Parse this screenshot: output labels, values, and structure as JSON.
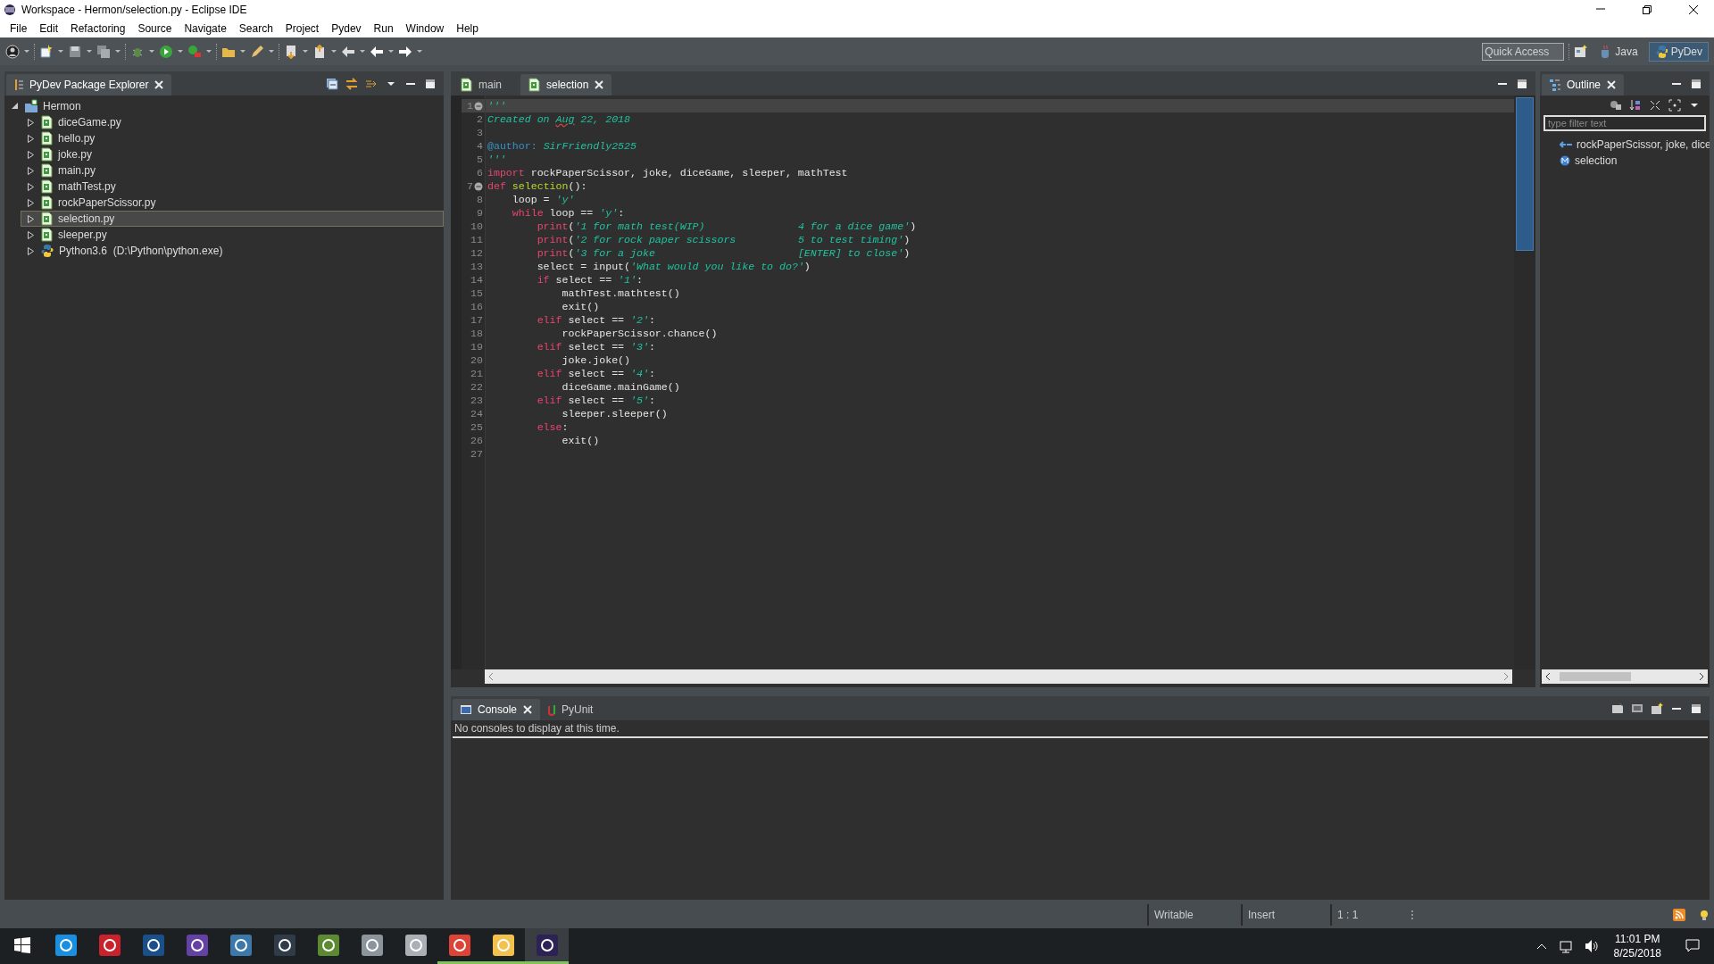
{
  "window": {
    "title": "Workspace - Hermon/selection.py - Eclipse IDE"
  },
  "menu": [
    "File",
    "Edit",
    "Refactoring",
    "Source",
    "Navigate",
    "Search",
    "Project",
    "Pydev",
    "Run",
    "Window",
    "Help"
  ],
  "toolbar": {
    "quick_access": {
      "placeholder": "Quick Access"
    },
    "perspectives": [
      {
        "label": "Java",
        "selected": false
      },
      {
        "label": "PyDev",
        "selected": true
      }
    ]
  },
  "explorer": {
    "title": "PyDev Package Explorer",
    "tree": [
      {
        "label": "Hermon",
        "kind": "project",
        "expanded": true,
        "selected": false,
        "children": [
          {
            "label": "diceGame.py",
            "kind": "file",
            "expanded": false,
            "selected": false
          },
          {
            "label": "hello.py",
            "kind": "file",
            "expanded": false,
            "selected": false
          },
          {
            "label": "joke.py",
            "kind": "file",
            "expanded": false,
            "selected": false
          },
          {
            "label": "main.py",
            "kind": "file",
            "expanded": false,
            "selected": false
          },
          {
            "label": "mathTest.py",
            "kind": "file",
            "expanded": false,
            "selected": false
          },
          {
            "label": "rockPaperScissor.py",
            "kind": "file",
            "expanded": false,
            "selected": false
          },
          {
            "label": "selection.py",
            "kind": "file",
            "expanded": false,
            "selected": true
          },
          {
            "label": "sleeper.py",
            "kind": "file",
            "expanded": false,
            "selected": false
          },
          {
            "label": "Python3.6  (D:\\Python\\python.exe)",
            "kind": "interpreter",
            "expanded": false,
            "selected": false
          }
        ]
      }
    ]
  },
  "editor": {
    "tabs": [
      {
        "label": "main",
        "selected": false
      },
      {
        "label": "selection",
        "selected": true
      }
    ],
    "lines": [
      {
        "number": "1",
        "fold": true,
        "current": true,
        "tokens": [
          {
            "kind": "string",
            "text": "'''"
          }
        ]
      },
      {
        "number": "2",
        "fold": false,
        "current": false,
        "tokens": [
          {
            "kind": "string",
            "text": "Created on "
          },
          {
            "kind": "string",
            "text": "Aug",
            "misspelled": true
          },
          {
            "kind": "string",
            "text": " 22, 2018"
          }
        ]
      },
      {
        "number": "3",
        "fold": false,
        "current": false
      },
      {
        "number": "4",
        "fold": false,
        "current": false,
        "tokens": [
          {
            "kind": "decorator",
            "text": "@author:"
          },
          {
            "kind": "string",
            "text": " SirFriendly2525"
          }
        ]
      },
      {
        "number": "5",
        "fold": false,
        "current": false,
        "tokens": [
          {
            "kind": "string",
            "text": "'''"
          }
        ]
      },
      {
        "number": "6",
        "fold": false,
        "current": false,
        "tokens": [
          {
            "kind": "keyword",
            "text": "import"
          },
          {
            "kind": "plain",
            "text": " rockPaperScissor, joke, diceGame, sleeper, mathTest"
          }
        ]
      },
      {
        "number": "7",
        "fold": true,
        "current": false,
        "tokens": [
          {
            "kind": "keyword",
            "text": "def "
          },
          {
            "kind": "function",
            "text": "selection"
          },
          {
            "kind": "plain",
            "text": "():"
          }
        ]
      },
      {
        "number": "8",
        "fold": false,
        "current": false,
        "tokens": [
          {
            "kind": "plain",
            "text": "    loop = "
          },
          {
            "kind": "string",
            "text": "'y'"
          }
        ]
      },
      {
        "number": "9",
        "fold": false,
        "current": false,
        "tokens": [
          {
            "kind": "keyword",
            "text": "    while"
          },
          {
            "kind": "plain",
            "text": " loop == "
          },
          {
            "kind": "string",
            "text": "'y'"
          },
          {
            "kind": "plain",
            "text": ":"
          }
        ]
      },
      {
        "number": "10",
        "fold": false,
        "current": false,
        "tokens": [
          {
            "kind": "keyword",
            "text": "        print"
          },
          {
            "kind": "plain",
            "text": "("
          },
          {
            "kind": "string",
            "text": "'1 for math test(WIP)               4 for a dice game'"
          },
          {
            "kind": "plain",
            "text": ")"
          }
        ]
      },
      {
        "number": "11",
        "fold": false,
        "current": false,
        "tokens": [
          {
            "kind": "keyword",
            "text": "        print"
          },
          {
            "kind": "plain",
            "text": "("
          },
          {
            "kind": "string",
            "text": "'2 for rock paper scissors          5 to test timing'"
          },
          {
            "kind": "plain",
            "text": ")"
          }
        ]
      },
      {
        "number": "12",
        "fold": false,
        "current": false,
        "tokens": [
          {
            "kind": "keyword",
            "text": "        print"
          },
          {
            "kind": "plain",
            "text": "("
          },
          {
            "kind": "string",
            "text": "'3 for a joke                       [ENTER] to close'"
          },
          {
            "kind": "plain",
            "text": ")"
          }
        ]
      },
      {
        "number": "13",
        "fold": false,
        "current": false,
        "tokens": [
          {
            "kind": "plain",
            "text": "        select = input("
          },
          {
            "kind": "string",
            "text": "'What would you like to do?'"
          },
          {
            "kind": "plain",
            "text": ")"
          }
        ]
      },
      {
        "number": "14",
        "fold": false,
        "current": false,
        "tokens": [
          {
            "kind": "keyword",
            "text": "        if"
          },
          {
            "kind": "plain",
            "text": " select == "
          },
          {
            "kind": "string",
            "text": "'1'"
          },
          {
            "kind": "plain",
            "text": ":"
          }
        ]
      },
      {
        "number": "15",
        "fold": false,
        "current": false,
        "tokens": [
          {
            "kind": "plain",
            "text": "            mathTest.mathtest()"
          }
        ]
      },
      {
        "number": "16",
        "fold": false,
        "current": false,
        "tokens": [
          {
            "kind": "plain",
            "text": "            exit()"
          }
        ]
      },
      {
        "number": "17",
        "fold": false,
        "current": false,
        "tokens": [
          {
            "kind": "keyword",
            "text": "        elif"
          },
          {
            "kind": "plain",
            "text": " select == "
          },
          {
            "kind": "string",
            "text": "'2'"
          },
          {
            "kind": "plain",
            "text": ":"
          }
        ]
      },
      {
        "number": "18",
        "fold": false,
        "current": false,
        "tokens": [
          {
            "kind": "plain",
            "text": "            rockPaperScissor.chance()"
          }
        ]
      },
      {
        "number": "19",
        "fold": false,
        "current": false,
        "tokens": [
          {
            "kind": "keyword",
            "text": "        elif"
          },
          {
            "kind": "plain",
            "text": " select == "
          },
          {
            "kind": "string",
            "text": "'3'"
          },
          {
            "kind": "plain",
            "text": ":"
          }
        ]
      },
      {
        "number": "20",
        "fold": false,
        "current": false,
        "tokens": [
          {
            "kind": "plain",
            "text": "            joke.joke()"
          }
        ]
      },
      {
        "number": "21",
        "fold": false,
        "current": false,
        "tokens": [
          {
            "kind": "keyword",
            "text": "        elif"
          },
          {
            "kind": "plain",
            "text": " select == "
          },
          {
            "kind": "string",
            "text": "'4'"
          },
          {
            "kind": "plain",
            "text": ":"
          }
        ]
      },
      {
        "number": "22",
        "fold": false,
        "current": false,
        "tokens": [
          {
            "kind": "plain",
            "text": "            diceGame.mainGame()"
          }
        ]
      },
      {
        "number": "23",
        "fold": false,
        "current": false,
        "tokens": [
          {
            "kind": "keyword",
            "text": "        elif"
          },
          {
            "kind": "plain",
            "text": " select == "
          },
          {
            "kind": "string",
            "text": "'5'"
          },
          {
            "kind": "plain",
            "text": ":"
          }
        ]
      },
      {
        "number": "24",
        "fold": false,
        "current": false,
        "tokens": [
          {
            "kind": "plain",
            "text": "            sleeper.sleeper()"
          }
        ]
      },
      {
        "number": "25",
        "fold": false,
        "current": false,
        "tokens": [
          {
            "kind": "keyword",
            "text": "        else"
          },
          {
            "kind": "plain",
            "text": ":"
          }
        ]
      },
      {
        "number": "26",
        "fold": false,
        "current": false,
        "tokens": [
          {
            "kind": "plain",
            "text": "            exit()"
          }
        ]
      },
      {
        "number": "27",
        "fold": false,
        "current": false
      }
    ]
  },
  "outline": {
    "title": "Outline",
    "filter": {
      "placeholder": "type filter text"
    },
    "items": [
      {
        "label": "rockPaperScissor, joke, dice",
        "kind": "import"
      },
      {
        "label": "selection",
        "kind": "method"
      }
    ]
  },
  "console": {
    "tabs": [
      {
        "label": "Console",
        "selected": true
      },
      {
        "label": "PyUnit",
        "selected": false
      }
    ],
    "message": "No consoles to display at this time."
  },
  "status_bar": [
    "Writable",
    "Insert",
    "1 : 1"
  ],
  "taskbar": {
    "apps": [
      {
        "color": "#1a8fe0",
        "running": false,
        "active": false
      },
      {
        "color": "#c8232c",
        "running": false,
        "active": false
      },
      {
        "color": "#1b4f8a",
        "running": false,
        "active": false
      },
      {
        "color": "#6441a4",
        "running": false,
        "active": false
      },
      {
        "color": "#3c78aa",
        "running": false,
        "active": false
      },
      {
        "color": "#2f3c48",
        "running": false,
        "active": false
      },
      {
        "color": "#5b8a32",
        "running": false,
        "active": false
      },
      {
        "color": "#8c959c",
        "running": false,
        "active": false
      },
      {
        "color": "#aab0b5",
        "running": false,
        "active": false
      },
      {
        "color": "#db4437",
        "running": true,
        "active": false
      },
      {
        "color": "#f2c14e",
        "running": true,
        "active": false
      },
      {
        "color": "#2c2255",
        "running": true,
        "active": true
      }
    ],
    "time": "11:01 PM",
    "date": "8/25/2018"
  }
}
